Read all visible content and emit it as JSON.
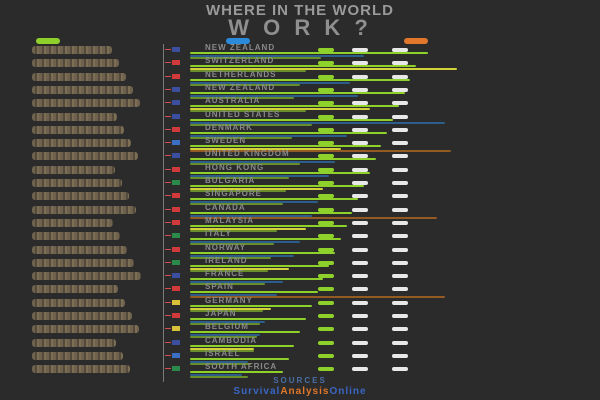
{
  "header": {
    "title_line1": "WHERE IN THE WORLD",
    "title_line2": "W O R K ?"
  },
  "legend": {
    "colors": [
      "#8fd12b",
      "#2b5e8a",
      "#d97a1e"
    ]
  },
  "rows": [
    {
      "country": "NEW ZEALAND",
      "flag": "#3a4fa0",
      "values": [
        0.82,
        0.6,
        0.45
      ]
    },
    {
      "country": "SWITZERLAND",
      "flag": "#d13a3a",
      "values": [
        0.78,
        0.92,
        0.4
      ]
    },
    {
      "country": "NETHERLANDS",
      "flag": "#d13a3a",
      "values": [
        0.76,
        0.55,
        0.38
      ]
    },
    {
      "country": "NEW ZEALAND",
      "flag": "#3a4fa0",
      "values": [
        0.74,
        0.58,
        0.36
      ]
    },
    {
      "country": "AUSTRALIA",
      "flag": "#3a4fa0",
      "values": [
        0.72,
        0.62,
        0.4
      ]
    },
    {
      "country": "UNITED STATES",
      "flag": "#3a4fa0",
      "values": [
        0.7,
        0.88,
        0.42
      ]
    },
    {
      "country": "DENMARK",
      "flag": "#d13a3a",
      "values": [
        0.68,
        0.54,
        0.35
      ]
    },
    {
      "country": "SWEDEN",
      "flag": "#3a6fc4",
      "values": [
        0.66,
        0.52,
        0.9
      ]
    },
    {
      "country": "UNITED KINGDOM",
      "flag": "#3a4fa0",
      "values": [
        0.64,
        0.5,
        0.38
      ]
    },
    {
      "country": "HONG KONG",
      "flag": "#d13a3a",
      "values": [
        0.62,
        0.48,
        0.34
      ]
    },
    {
      "country": "BULGARIA",
      "flag": "#2b8a4a",
      "values": [
        0.6,
        0.46,
        0.33
      ]
    },
    {
      "country": "SINGAPORE",
      "flag": "#d13a3a",
      "values": [
        0.58,
        0.44,
        0.32
      ]
    },
    {
      "country": "CANADA",
      "flag": "#d13a3a",
      "values": [
        0.56,
        0.42,
        0.85
      ]
    },
    {
      "country": "MALAYSIA",
      "flag": "#d13a3a",
      "values": [
        0.54,
        0.4,
        0.3
      ]
    },
    {
      "country": "ITALY",
      "flag": "#2b8a4a",
      "values": [
        0.52,
        0.38,
        0.29
      ]
    },
    {
      "country": "NORWAY",
      "flag": "#d13a3a",
      "values": [
        0.5,
        0.36,
        0.28
      ]
    },
    {
      "country": "IRELAND",
      "flag": "#2b8a4a",
      "values": [
        0.48,
        0.34,
        0.27
      ]
    },
    {
      "country": "FRANCE",
      "flag": "#3a4fa0",
      "values": [
        0.46,
        0.32,
        0.26
      ]
    },
    {
      "country": "SPAIN",
      "flag": "#d13a3a",
      "values": [
        0.44,
        0.3,
        0.88
      ]
    },
    {
      "country": "GERMANY",
      "flag": "#d9c23a",
      "values": [
        0.42,
        0.28,
        0.25
      ]
    },
    {
      "country": "JAPAN",
      "flag": "#d13a3a",
      "values": [
        0.4,
        0.26,
        0.24
      ]
    },
    {
      "country": "BELGIUM",
      "flag": "#d9c23a",
      "values": [
        0.38,
        0.24,
        0.23
      ]
    },
    {
      "country": "CAMBODIA",
      "flag": "#3a4fa0",
      "values": [
        0.36,
        0.22,
        0.22
      ]
    },
    {
      "country": "ISRAEL",
      "flag": "#3a6fc4",
      "values": [
        0.34,
        0.2,
        0.21
      ]
    },
    {
      "country": "SOUTH AFRICA",
      "flag": "#2b8a4a",
      "values": [
        0.32,
        0.18,
        0.2
      ]
    }
  ],
  "footer": {
    "sources": "SOURCES",
    "brand1": "Survival",
    "brand2": "Analysis",
    "brand3": "Online"
  },
  "chart_data": {
    "type": "bar",
    "title": "WHERE IN THE WORLD",
    "categories": [
      "NEW ZEALAND",
      "SWITZERLAND",
      "NETHERLANDS",
      "NEW ZEALAND",
      "AUSTRALIA",
      "UNITED STATES",
      "DENMARK",
      "SWEDEN",
      "UNITED KINGDOM",
      "HONG KONG",
      "BULGARIA",
      "SINGAPORE",
      "CANADA",
      "MALAYSIA",
      "ITALY",
      "NORWAY",
      "IRELAND",
      "FRANCE",
      "SPAIN",
      "GERMANY",
      "JAPAN",
      "BELGIUM",
      "CAMBODIA",
      "ISRAEL",
      "SOUTH AFRICA"
    ],
    "series": [
      {
        "values": [
          0.82,
          0.78,
          0.76,
          0.74,
          0.72,
          0.7,
          0.68,
          0.66,
          0.64,
          0.62,
          0.6,
          0.58,
          0.56,
          0.54,
          0.52,
          0.5,
          0.48,
          0.46,
          0.44,
          0.42,
          0.4,
          0.38,
          0.36,
          0.34,
          0.32
        ]
      },
      {
        "values": [
          0.6,
          0.92,
          0.55,
          0.58,
          0.62,
          0.88,
          0.54,
          0.52,
          0.5,
          0.48,
          0.46,
          0.44,
          0.42,
          0.4,
          0.38,
          0.36,
          0.34,
          0.32,
          0.3,
          0.28,
          0.26,
          0.24,
          0.22,
          0.2,
          0.18
        ]
      },
      {
        "values": [
          0.45,
          0.4,
          0.38,
          0.36,
          0.4,
          0.42,
          0.35,
          0.9,
          0.38,
          0.34,
          0.33,
          0.32,
          0.85,
          0.3,
          0.29,
          0.28,
          0.27,
          0.26,
          0.88,
          0.25,
          0.24,
          0.23,
          0.22,
          0.21,
          0.2
        ]
      }
    ],
    "legend": "top",
    "grid": false
  }
}
